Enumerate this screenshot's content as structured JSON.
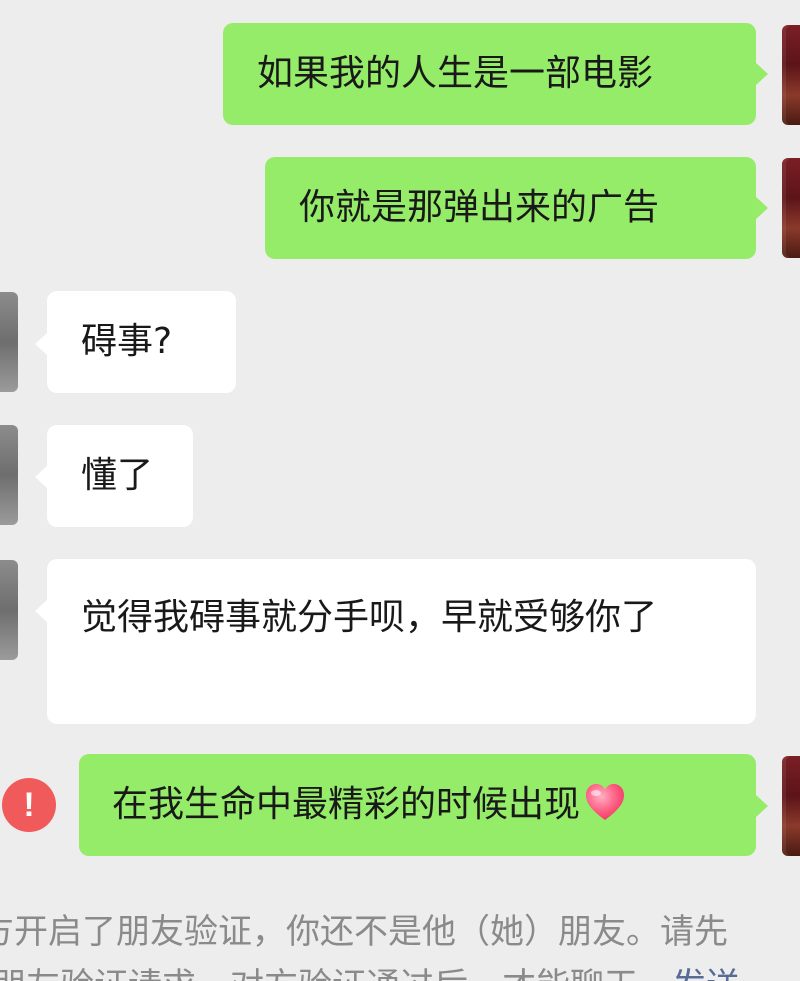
{
  "messages": [
    {
      "side": "out",
      "text": "如果我的人生是一部电影"
    },
    {
      "side": "out",
      "text": "你就是那弹出来的广告"
    },
    {
      "side": "in",
      "text": "碍事?"
    },
    {
      "side": "in",
      "text": "懂了"
    },
    {
      "side": "in",
      "text": "觉得我碍事就分手呗，早就受够你了"
    },
    {
      "side": "out",
      "text": "在我生命中最精彩的时候出现",
      "emoji": "heart-emoji",
      "status": "failed"
    }
  ],
  "system_notice": {
    "line1": "方开启了朋友验证，你还不是他（她）朋友。请先",
    "line2": "朋友验证请求，对方验证通过后，才能聊天。",
    "link": "发送"
  },
  "colors": {
    "background": "#ededed",
    "outgoing_bubble": "#95ec69",
    "incoming_bubble": "#ffffff",
    "error": "#f05a5a",
    "link": "#576b95"
  }
}
